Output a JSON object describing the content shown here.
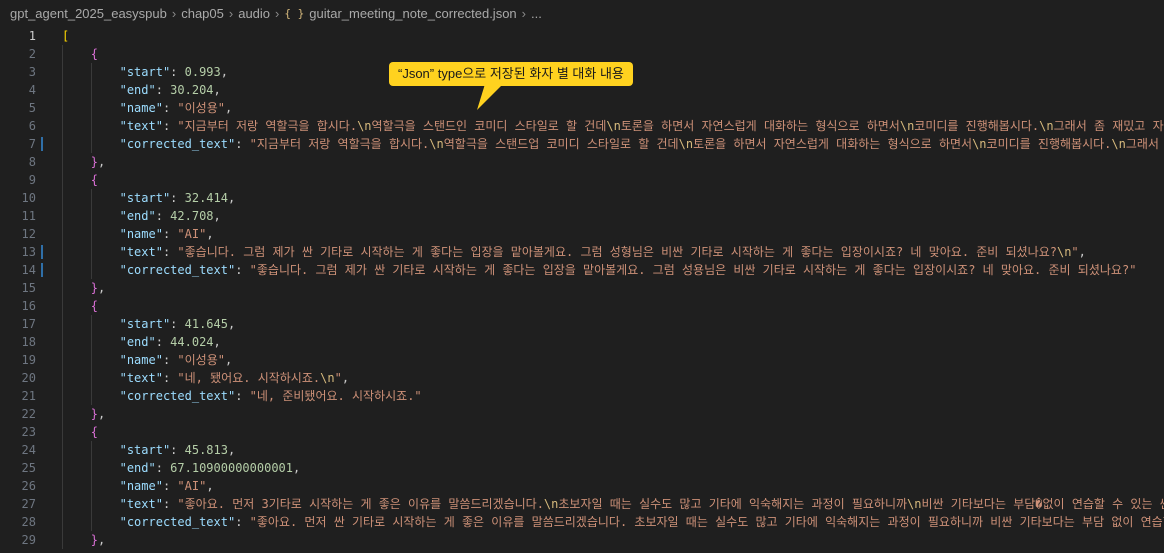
{
  "breadcrumb": {
    "items": [
      "gpt_agent_2025_easyspub",
      "chap05",
      "audio",
      "guitar_meeting_note_corrected.json",
      "..."
    ],
    "json_icon": "{ }"
  },
  "callout": {
    "text": "“Json” type으로 저장된 화자 별 대화 내용",
    "color": "#ffd21f"
  },
  "editor": {
    "active_line": 1,
    "modified_lines": [
      7,
      13,
      14
    ],
    "lines": [
      {
        "n": 1,
        "t": [
          [
            "[",
            "bracket1"
          ]
        ]
      },
      {
        "n": 2,
        "t": [
          [
            "{",
            "bracket2"
          ]
        ],
        "indent": 1
      },
      {
        "n": 3,
        "t": [
          [
            "\"start\"",
            "key"
          ],
          [
            ": ",
            "punc"
          ],
          [
            "0.993",
            "num"
          ],
          [
            ",",
            "punc"
          ]
        ],
        "indent": 2
      },
      {
        "n": 4,
        "t": [
          [
            "\"end\"",
            "key"
          ],
          [
            ": ",
            "punc"
          ],
          [
            "30.204",
            "num"
          ],
          [
            ",",
            "punc"
          ]
        ],
        "indent": 2
      },
      {
        "n": 5,
        "t": [
          [
            "\"name\"",
            "key"
          ],
          [
            ": ",
            "punc"
          ],
          [
            "\"이성용\"",
            "str"
          ],
          [
            ",",
            "punc"
          ]
        ],
        "indent": 2
      },
      {
        "n": 6,
        "t": [
          [
            "\"text\"",
            "key"
          ],
          [
            ": ",
            "punc"
          ],
          [
            "\"지금부터 저랑 역할극을 합시다.",
            "str"
          ],
          [
            "\\n",
            "esc"
          ],
          [
            "역할극을 스탠드인 코미디 스타일로 할 건데",
            "str"
          ],
          [
            "\\n",
            "esc"
          ],
          [
            "토론을 하면서 자연스럽게 대화하는 형식으로 하면서",
            "str"
          ],
          [
            "\\n",
            "esc"
          ],
          [
            "코미디를 진행해봅시다.",
            "str"
          ],
          [
            "\\n",
            "esc"
          ],
          [
            "그래서 좀 재밌고 자연스럽고",
            "str"
          ]
        ],
        "indent": 2
      },
      {
        "n": 7,
        "t": [
          [
            "\"corrected_text\"",
            "key"
          ],
          [
            ": ",
            "punc"
          ],
          [
            "\"지금부터 저랑 역할극을 합시다.",
            "str"
          ],
          [
            "\\n",
            "esc"
          ],
          [
            "역할극을 스탠드업 코미디 스타일로 할 건데",
            "str"
          ],
          [
            "\\n",
            "esc"
          ],
          [
            "토론을 하면서 자연스럽게 대화하는 형식으로 하면서",
            "str"
          ],
          [
            "\\n",
            "esc"
          ],
          [
            "코미디를 진행해봅시다.",
            "str"
          ],
          [
            "\\n",
            "esc"
          ],
          [
            "그래서 좀 재밌고",
            "str"
          ]
        ],
        "indent": 2
      },
      {
        "n": 8,
        "t": [
          [
            "}",
            "bracket2"
          ],
          [
            ",",
            "punc"
          ]
        ],
        "indent": 1
      },
      {
        "n": 9,
        "t": [
          [
            "{",
            "bracket2"
          ]
        ],
        "indent": 1
      },
      {
        "n": 10,
        "t": [
          [
            "\"start\"",
            "key"
          ],
          [
            ": ",
            "punc"
          ],
          [
            "32.414",
            "num"
          ],
          [
            ",",
            "punc"
          ]
        ],
        "indent": 2
      },
      {
        "n": 11,
        "t": [
          [
            "\"end\"",
            "key"
          ],
          [
            ": ",
            "punc"
          ],
          [
            "42.708",
            "num"
          ],
          [
            ",",
            "punc"
          ]
        ],
        "indent": 2
      },
      {
        "n": 12,
        "t": [
          [
            "\"name\"",
            "key"
          ],
          [
            ": ",
            "punc"
          ],
          [
            "\"AI\"",
            "str"
          ],
          [
            ",",
            "punc"
          ]
        ],
        "indent": 2
      },
      {
        "n": 13,
        "t": [
          [
            "\"text\"",
            "key"
          ],
          [
            ": ",
            "punc"
          ],
          [
            "\"좋습니다. 그럼 제가 싼 기타로 시작하는 게 좋다는 입장을 맡아볼게요. 그럼 성형님은 비싼 기타로 시작하는 게 좋다는 입장이시죠? 네 맞아요. 준비 되셨나요?",
            "str"
          ],
          [
            "\\n",
            "esc"
          ],
          [
            "\"",
            "str"
          ],
          [
            ",",
            "punc"
          ]
        ],
        "indent": 2
      },
      {
        "n": 14,
        "t": [
          [
            "\"corrected_text\"",
            "key"
          ],
          [
            ": ",
            "punc"
          ],
          [
            "\"좋습니다. 그럼 제가 싼 기타로 시작하는 게 좋다는 입장을 맡아볼게요. 그럼 성용님은 비싼 기타로 시작하는 게 좋다는 입장이시죠? 네 맞아요. 준비 되셨나요?\"",
            "str"
          ]
        ],
        "indent": 2
      },
      {
        "n": 15,
        "t": [
          [
            "}",
            "bracket2"
          ],
          [
            ",",
            "punc"
          ]
        ],
        "indent": 1
      },
      {
        "n": 16,
        "t": [
          [
            "{",
            "bracket2"
          ]
        ],
        "indent": 1
      },
      {
        "n": 17,
        "t": [
          [
            "\"start\"",
            "key"
          ],
          [
            ": ",
            "punc"
          ],
          [
            "41.645",
            "num"
          ],
          [
            ",",
            "punc"
          ]
        ],
        "indent": 2
      },
      {
        "n": 18,
        "t": [
          [
            "\"end\"",
            "key"
          ],
          [
            ": ",
            "punc"
          ],
          [
            "44.024",
            "num"
          ],
          [
            ",",
            "punc"
          ]
        ],
        "indent": 2
      },
      {
        "n": 19,
        "t": [
          [
            "\"name\"",
            "key"
          ],
          [
            ": ",
            "punc"
          ],
          [
            "\"이성용\"",
            "str"
          ],
          [
            ",",
            "punc"
          ]
        ],
        "indent": 2
      },
      {
        "n": 20,
        "t": [
          [
            "\"text\"",
            "key"
          ],
          [
            ": ",
            "punc"
          ],
          [
            "\"네, 됐어요. 시작하시죠.",
            "str"
          ],
          [
            "\\n",
            "esc"
          ],
          [
            "\"",
            "str"
          ],
          [
            ",",
            "punc"
          ]
        ],
        "indent": 2
      },
      {
        "n": 21,
        "t": [
          [
            "\"corrected_text\"",
            "key"
          ],
          [
            ": ",
            "punc"
          ],
          [
            "\"네, 준비됐어요. 시작하시죠.\"",
            "str"
          ]
        ],
        "indent": 2
      },
      {
        "n": 22,
        "t": [
          [
            "}",
            "bracket2"
          ],
          [
            ",",
            "punc"
          ]
        ],
        "indent": 1
      },
      {
        "n": 23,
        "t": [
          [
            "{",
            "bracket2"
          ]
        ],
        "indent": 1
      },
      {
        "n": 24,
        "t": [
          [
            "\"start\"",
            "key"
          ],
          [
            ": ",
            "punc"
          ],
          [
            "45.813",
            "num"
          ],
          [
            ",",
            "punc"
          ]
        ],
        "indent": 2
      },
      {
        "n": 25,
        "t": [
          [
            "\"end\"",
            "key"
          ],
          [
            ": ",
            "punc"
          ],
          [
            "67.10900000000001",
            "num"
          ],
          [
            ",",
            "punc"
          ]
        ],
        "indent": 2
      },
      {
        "n": 26,
        "t": [
          [
            "\"name\"",
            "key"
          ],
          [
            ": ",
            "punc"
          ],
          [
            "\"AI\"",
            "str"
          ],
          [
            ",",
            "punc"
          ]
        ],
        "indent": 2
      },
      {
        "n": 27,
        "t": [
          [
            "\"text\"",
            "key"
          ],
          [
            ": ",
            "punc"
          ],
          [
            "\"좋아요. 먼저 3기타로 시작하는 게 좋은 이유를 말씀드리겠습니다.",
            "str"
          ],
          [
            "\\n",
            "esc"
          ],
          [
            "초보자일 때는 실수도 많고 기타에 익숙해지는 과정이 필요하니까",
            "str"
          ],
          [
            "\\n",
            "esc"
          ],
          [
            "비싼 기타보다는 부담�없이 연습할 수 있는 싼 기타가",
            "str"
          ]
        ],
        "indent": 2
      },
      {
        "n": 28,
        "t": [
          [
            "\"corrected_text\"",
            "key"
          ],
          [
            ": ",
            "punc"
          ],
          [
            "\"좋아요. 먼저 싼 기타로 시작하는 게 좋은 이유를 말씀드리겠습니다. 초보자일 때는 실수도 많고 기타에 익숙해지는 과정이 필요하니까 비싼 기타보다는 부담 없이 연습할 수 있는",
            "str"
          ]
        ],
        "indent": 2
      },
      {
        "n": 29,
        "t": [
          [
            "}",
            "bracket2"
          ],
          [
            ",",
            "punc"
          ]
        ],
        "indent": 1
      }
    ]
  }
}
